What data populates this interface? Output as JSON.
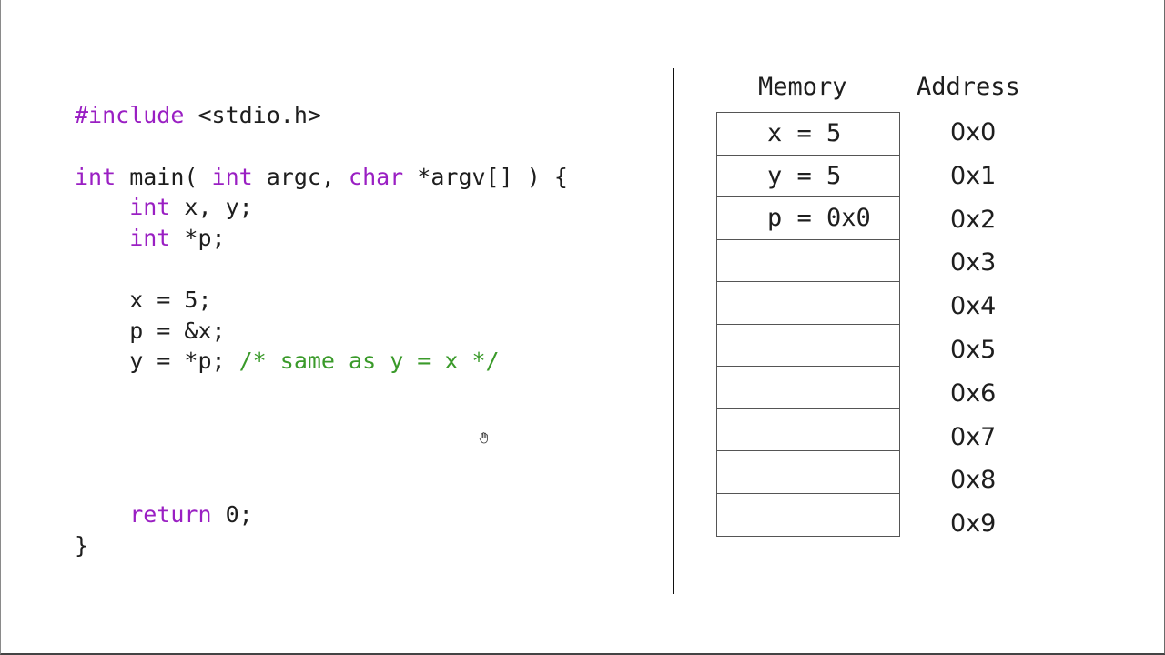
{
  "code": {
    "lines": [
      [
        {
          "t": "#include",
          "k": "kw"
        },
        {
          "t": " <stdio.h>",
          "k": ""
        }
      ],
      [],
      [
        {
          "t": "int",
          "k": "kw"
        },
        {
          "t": " main( ",
          "k": ""
        },
        {
          "t": "int",
          "k": "kw"
        },
        {
          "t": " argc, ",
          "k": ""
        },
        {
          "t": "char",
          "k": "kw"
        },
        {
          "t": " *argv[] ) {",
          "k": ""
        }
      ],
      [
        {
          "t": "    ",
          "k": ""
        },
        {
          "t": "int",
          "k": "kw"
        },
        {
          "t": " x, y;",
          "k": ""
        }
      ],
      [
        {
          "t": "    ",
          "k": ""
        },
        {
          "t": "int",
          "k": "kw"
        },
        {
          "t": " *p;",
          "k": ""
        }
      ],
      [],
      [
        {
          "t": "    x = 5;",
          "k": ""
        }
      ],
      [
        {
          "t": "    p = &x;",
          "k": ""
        }
      ],
      [
        {
          "t": "    y = *p; ",
          "k": ""
        },
        {
          "t": "/* same as y = x */",
          "k": "cm"
        }
      ],
      [],
      [],
      [],
      [],
      [
        {
          "t": "    ",
          "k": ""
        },
        {
          "t": "return",
          "k": "kw"
        },
        {
          "t": " 0;",
          "k": ""
        }
      ],
      [
        {
          "t": "}",
          "k": ""
        }
      ]
    ]
  },
  "memory": {
    "memory_header": "Memory",
    "address_header": "Address",
    "cells": [
      "x = 5",
      "y = 5",
      "p = 0x0",
      "",
      "",
      "",
      "",
      "",
      "",
      ""
    ],
    "addresses": [
      "0x0",
      "0x1",
      "0x2",
      "0x3",
      "0x4",
      "0x5",
      "0x6",
      "0x7",
      "0x8",
      "0x9"
    ]
  },
  "colors": {
    "keyword": "#9a1fc3",
    "comment": "#3a9a2a",
    "text": "#1e1e1e"
  }
}
